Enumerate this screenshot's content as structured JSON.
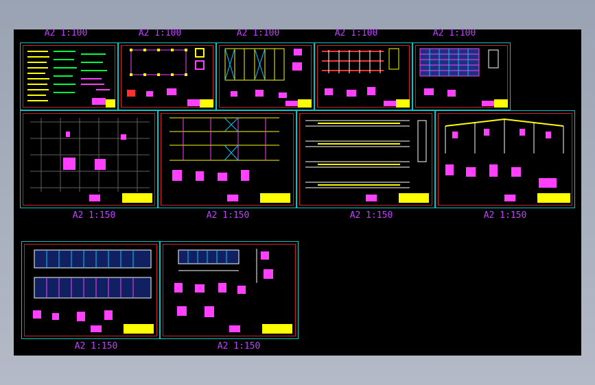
{
  "viewer": {
    "background_color": "#000000",
    "sheet_border_color": "#00c8c8",
    "frame_color": "#d02020",
    "label_color": "#c040ff"
  },
  "sheets": [
    {
      "scale_label": "A2 1:100"
    },
    {
      "scale_label": "A2 1:100"
    },
    {
      "scale_label": "A2 1:100"
    },
    {
      "scale_label": "A2 1:100"
    },
    {
      "scale_label": "A2 1:100"
    },
    {
      "scale_label": "A2 1:150"
    },
    {
      "scale_label": "A2 1:150"
    },
    {
      "scale_label": "A2 1:150"
    },
    {
      "scale_label": "A2 1:150"
    },
    {
      "scale_label": "A2 1:150"
    },
    {
      "scale_label": "A2 1:150"
    }
  ]
}
